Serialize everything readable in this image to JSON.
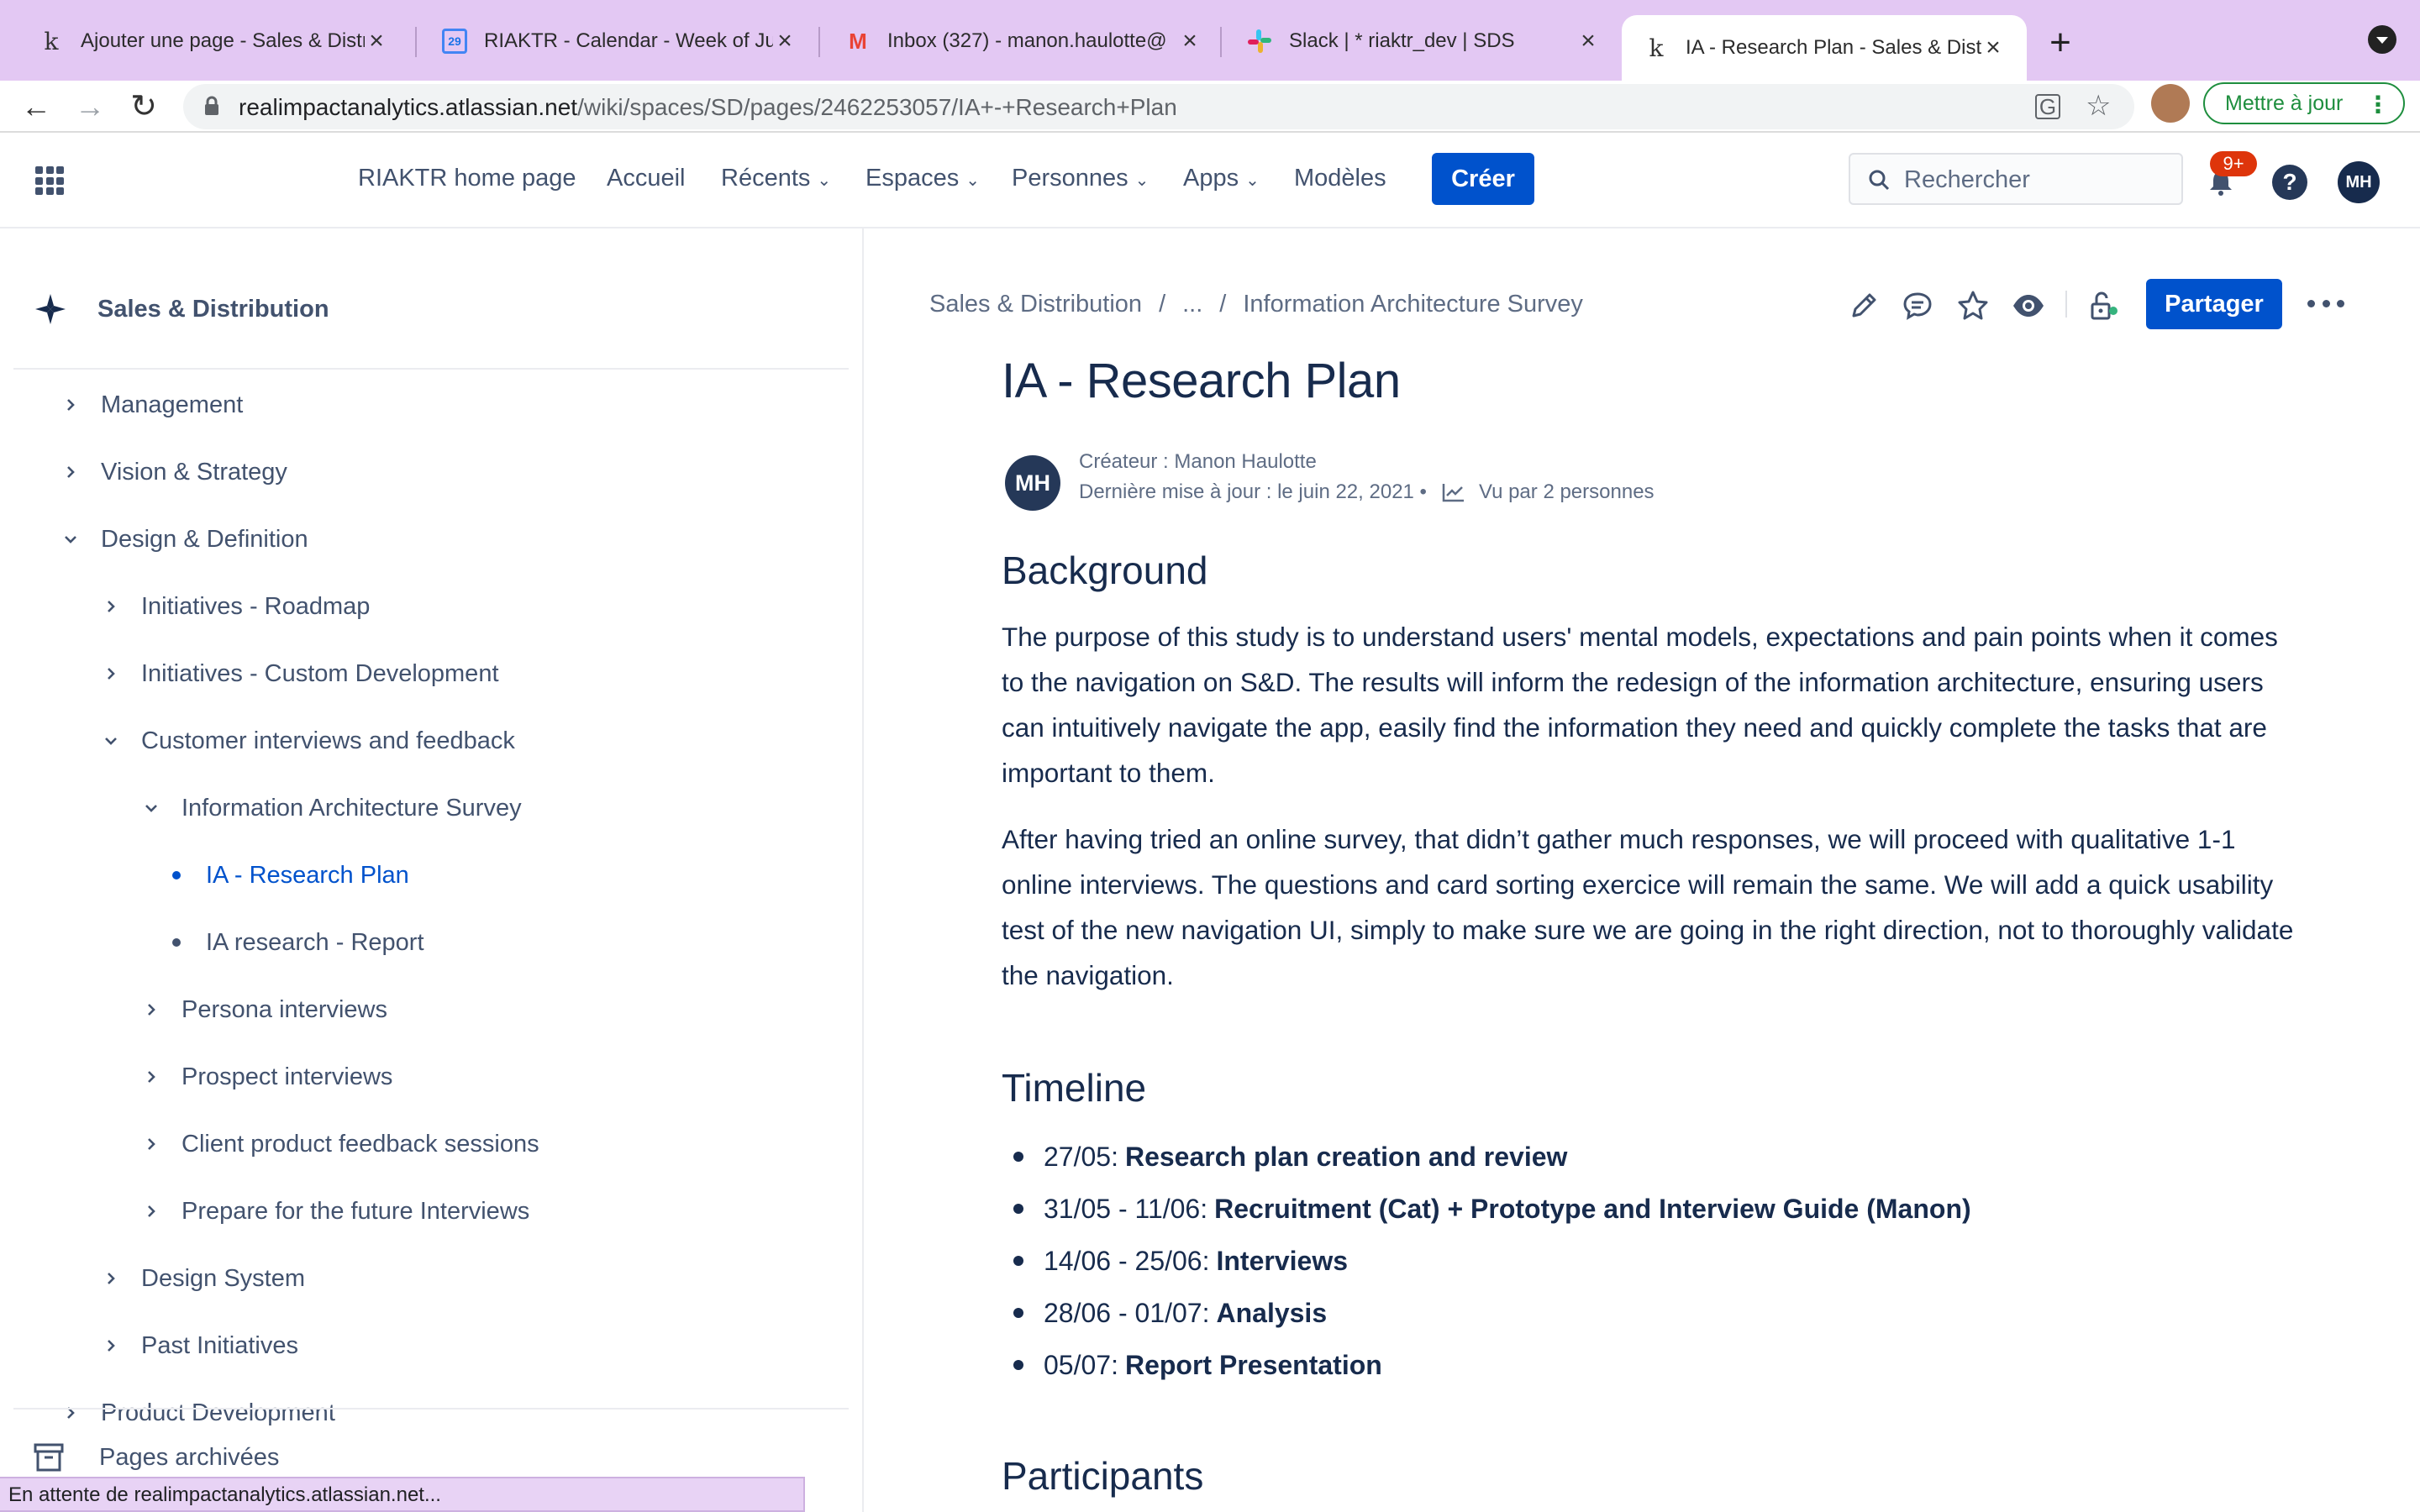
{
  "browser": {
    "tabs": [
      {
        "title": "Ajouter une page - Sales & Distribution",
        "favicon": "k"
      },
      {
        "title": "RIAKTR - Calendar - Week of June",
        "favicon": "29"
      },
      {
        "title": "Inbox (327) - manon.haulotte@",
        "favicon": "M"
      },
      {
        "title": "Slack | * riaktr_dev | SDS",
        "favicon": "slack"
      },
      {
        "title": "IA - Research Plan - Sales & Distribution",
        "favicon": "k"
      }
    ],
    "url_host": "realimpactanalytics.atlassian.net",
    "url_path": "/wiki/spaces/SD/pages/2462253057/IA+-+Research+Plan",
    "update_button": "Mettre à jour",
    "status_text": "En attente de realimpactanalytics.atlassian.net..."
  },
  "nav": {
    "items": [
      "RIAKTR home page",
      "Accueil",
      "Récents",
      "Espaces",
      "Personnes",
      "Apps",
      "Modèles"
    ],
    "create": "Créer",
    "search_placeholder": "Rechercher",
    "notifications": "9+",
    "help": "?",
    "user_initials": "MH"
  },
  "sidebar": {
    "space_name": "Sales & Distribution",
    "items": [
      {
        "label": "Management"
      },
      {
        "label": "Vision & Strategy"
      },
      {
        "label": "Design & Definition"
      },
      {
        "label": "Initiatives - Roadmap"
      },
      {
        "label": "Initiatives - Custom Development"
      },
      {
        "label": "Customer interviews and feedback"
      },
      {
        "label": "Information Architecture Survey"
      },
      {
        "label": "IA - Research Plan"
      },
      {
        "label": "IA research - Report"
      },
      {
        "label": "Persona interviews"
      },
      {
        "label": "Prospect interviews"
      },
      {
        "label": "Client product feedback sessions"
      },
      {
        "label": "Prepare for the future Interviews"
      },
      {
        "label": "Design System"
      },
      {
        "label": "Past Initiatives"
      },
      {
        "label": "Product Development"
      }
    ],
    "archived": "Pages archivées"
  },
  "page": {
    "breadcrumb": [
      "Sales & Distribution",
      "...",
      "Information Architecture Survey"
    ],
    "share": "Partager",
    "title": "IA - Research Plan",
    "avatar_initials": "MH",
    "creator": "Créateur : Manon Haulotte",
    "last_updated": "Dernière mise à jour : le juin 22, 2021 •",
    "views": "Vu par 2 personnes",
    "background_heading": "Background",
    "background_p1": "The purpose of this study is to understand users' mental models, expectations and pain points when it comes to the navigation on S&D. The results will inform the redesign of the information architecture, ensuring users can intuitively navigate the app, easily find the information they need and quickly complete the tasks that are important to them.",
    "background_p2": "After having tried an online survey, that didn’t gather much responses, we will proceed with qualitative 1-1 online interviews. The questions and card sorting exercice will remain the same. We will add a quick usability test of the new navigation UI, simply to make sure we are going in the right direction, not to thoroughly validate the navigation.",
    "timeline_heading": "Timeline",
    "timeline": [
      {
        "date": "27/05:",
        "task": "Research plan creation and review"
      },
      {
        "date": "31/05 - 11/06:",
        "task": "Recruitment (Cat) + Prototype and Interview Guide (Manon)"
      },
      {
        "date": "14/06 - 25/06:",
        "task": "Interviews"
      },
      {
        "date": "28/06 - 01/07:",
        "task": "Analysis"
      },
      {
        "date": "05/07:",
        "task": "Report Presentation"
      }
    ],
    "participants_heading": "Participants"
  },
  "colors": {
    "accent": "#0052cc",
    "text": "#172b4d",
    "subtle": "#42526e",
    "tabbar": "#e3c8f3",
    "badge": "#de350b"
  }
}
